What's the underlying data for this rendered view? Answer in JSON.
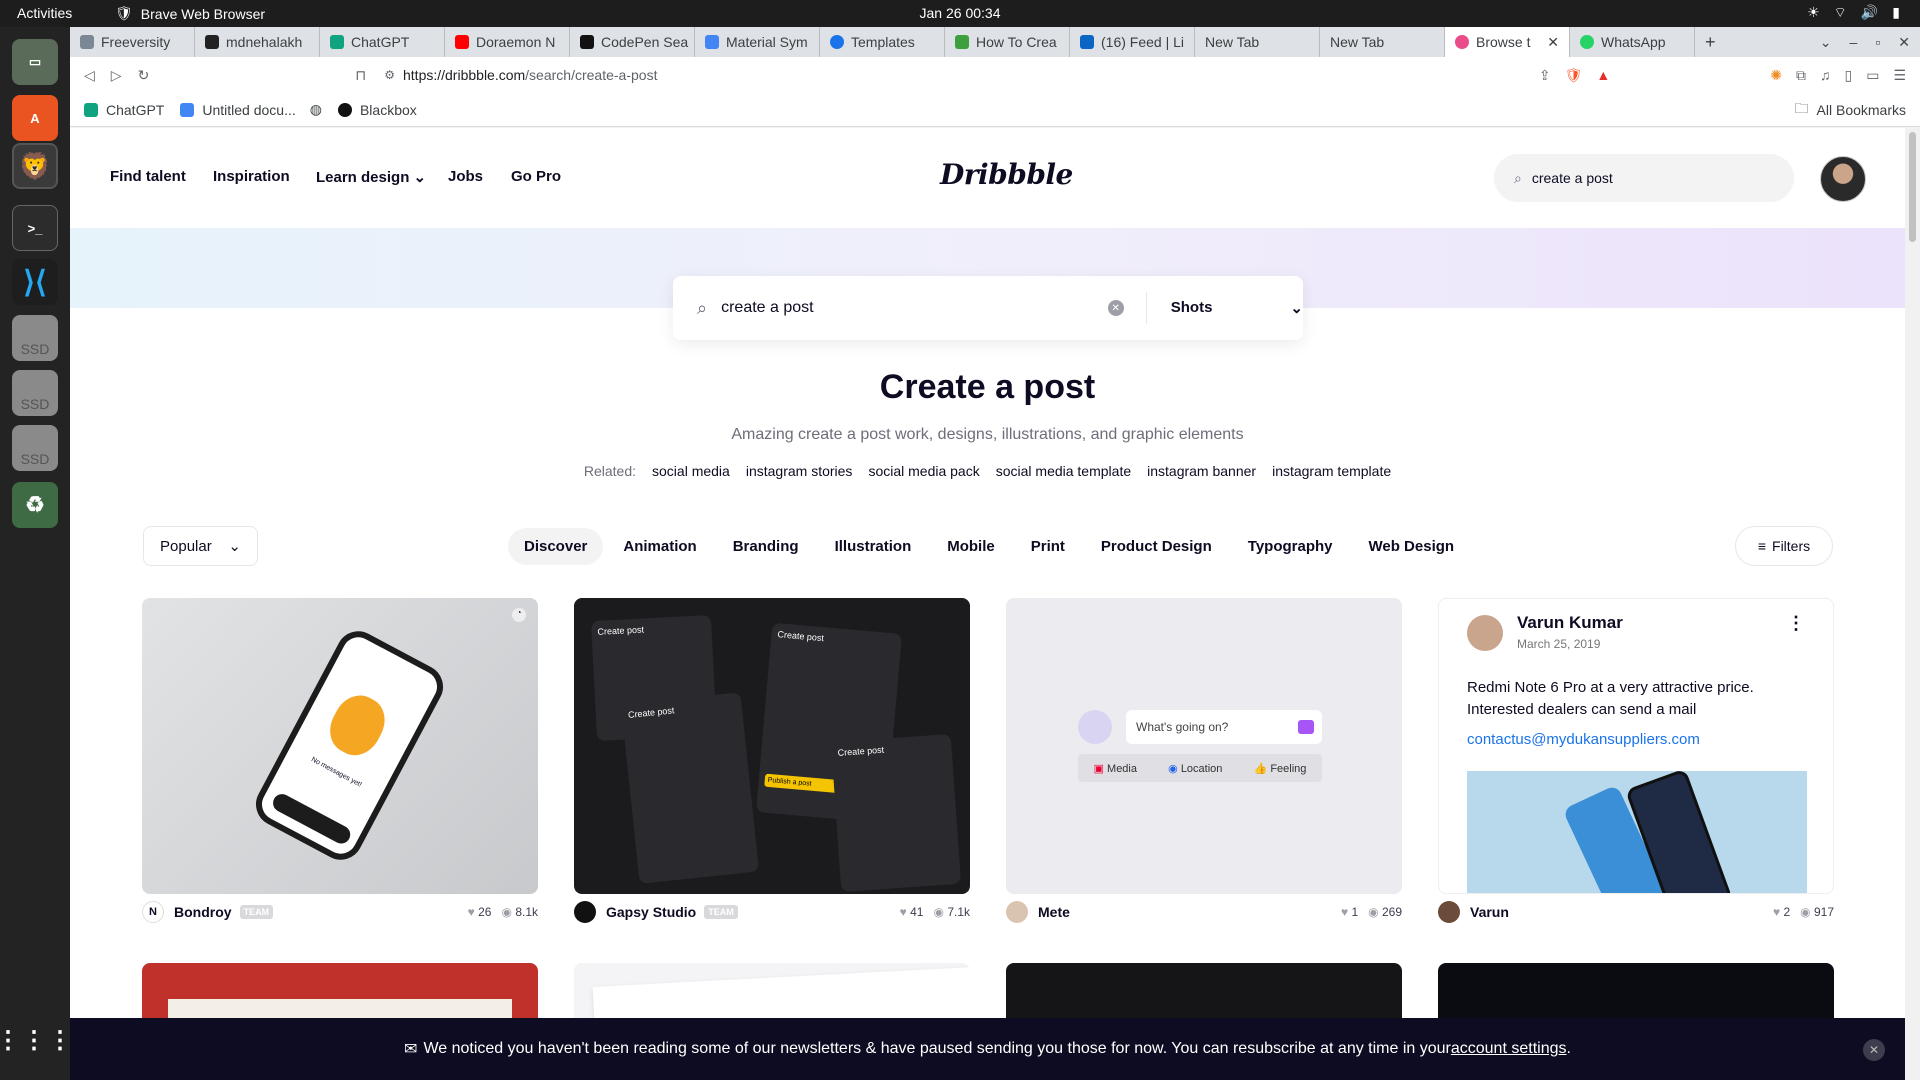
{
  "os": {
    "activities": "Activities",
    "app_name": "Brave Web Browser",
    "clock": "Jan 26  00:34"
  },
  "tabs": [
    {
      "label": "Freeversity",
      "color": "#7b8794"
    },
    {
      "label": "mdnehalakh",
      "color": "#222222"
    },
    {
      "label": "ChatGPT",
      "color": "#10a37f"
    },
    {
      "label": "Doraemon N",
      "color": "#ff0000"
    },
    {
      "label": "CodePen Sea",
      "color": "#111111"
    },
    {
      "label": "Material Sym",
      "color": "#4285f4"
    },
    {
      "label": "Templates",
      "color": "#1a73e8"
    },
    {
      "label": "How To Crea",
      "color": "#3d9f3d"
    },
    {
      "label": "(16) Feed | Li",
      "color": "#0a66c2"
    },
    {
      "label": "New Tab",
      "color": ""
    },
    {
      "label": "New Tab",
      "color": ""
    },
    {
      "label": "Browse t",
      "color": "#ea4c89"
    },
    {
      "label": "WhatsApp",
      "color": "#25d366"
    }
  ],
  "url_host": "https://dribbble.com",
  "url_path": "/search/create-a-post",
  "bookmarks": {
    "items": [
      "ChatGPT",
      "Untitled docu...",
      "",
      "Blackbox"
    ],
    "all": "All Bookmarks"
  },
  "nav": {
    "items": [
      "Find talent",
      "Inspiration",
      "Learn design",
      "Jobs",
      "Go Pro"
    ],
    "logo": "Dribbble",
    "search": "create a post"
  },
  "search": {
    "query": "create a post",
    "scope": "Shots"
  },
  "heading": {
    "title": "Create a post",
    "subtitle": "Amazing create a post work, designs, illustrations, and graphic elements"
  },
  "related": {
    "label": "Related:",
    "tags": [
      "social media",
      "instagram stories",
      "social media pack",
      "social media template",
      "instagram banner",
      "instagram template"
    ]
  },
  "sort": "Popular",
  "categories": [
    "Discover",
    "Animation",
    "Branding",
    "Illustration",
    "Mobile",
    "Print",
    "Product Design",
    "Typography",
    "Web Design"
  ],
  "filters": "Filters",
  "shots": [
    {
      "author": "Bondroy",
      "team": "TEAM",
      "likes": "26",
      "views": "8.1k"
    },
    {
      "author": "Gapsy Studio",
      "team": "TEAM",
      "likes": "41",
      "views": "7.1k"
    },
    {
      "author": "Mete",
      "team": "",
      "likes": "1",
      "views": "269"
    },
    {
      "author": "Varun",
      "team": "",
      "likes": "2",
      "views": "917"
    }
  ],
  "shot_text": {
    "phone_msg": "No messages yet!",
    "gapsy": [
      "Create post",
      "Create post",
      "Create post",
      "Create post",
      "Publish a post"
    ],
    "mete": {
      "prompt": "What's going on?",
      "b1": "Media",
      "b2": "Location",
      "b3": "Feeling"
    },
    "varun": {
      "name": "Varun Kumar",
      "date": "March 25, 2019",
      "body": "Redmi Note 6 Pro at a very attractive price. Interested dealers can send a mail",
      "email": "contactus@mydukansuppliers.com"
    }
  },
  "banner": {
    "text": "We noticed you haven't been reading some of our newsletters & have paused sending you those for now. You can resubscribe at any time in your ",
    "link": "account settings",
    "end": "."
  }
}
